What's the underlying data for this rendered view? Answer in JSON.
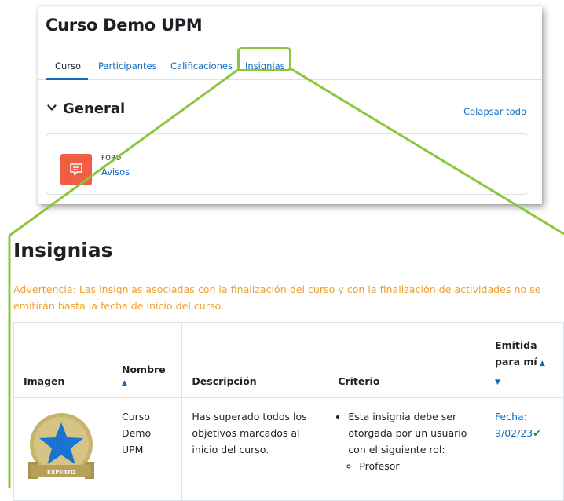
{
  "course": {
    "title": "Curso Demo UPM",
    "tabs": [
      "Curso",
      "Participantes",
      "Calificaciones",
      "Insignias"
    ],
    "section_title": "General",
    "collapse_all": "Colapsar todo",
    "activity": {
      "type": "FORO",
      "name": "Avisos"
    }
  },
  "badges": {
    "title": "Insignias",
    "warning": "Advertencia: Las insignias asociadas con la finalización del curso y con la finalización de actividades no se emitirán hasta la fecha de inicio del curso.",
    "headers": {
      "image": "Imagen",
      "name": "Nombre",
      "description": "Descripción",
      "criteria": "Criterio",
      "issued_line1": "Emitida",
      "issued_line2": "para mí"
    },
    "rows": [
      {
        "badge_label": "EXPERTO",
        "name_line1": "Curso",
        "name_line2": "Demo UPM",
        "description": "Has superado todos los objetivos marcados al inicio del curso.",
        "criteria_main": "Esta insignia debe ser otorgada por un usuario con el siguiente rol:",
        "criteria_role": "Profesor",
        "date_label": "Fecha:",
        "date_value": "9/02/23"
      }
    ]
  },
  "colors": {
    "highlight": "#8cc63f",
    "link": "#0f6cbf",
    "warning": "#f0a030",
    "forum_icon": "#f05d43",
    "check": "#198754",
    "badge_gold": "#c9b26b",
    "badge_star": "#1a73d1"
  },
  "icons": {
    "chevron": "chevron-down-icon",
    "forum": "forum-chat-icon",
    "sort_up": "sort-asc-icon",
    "sort_down": "sort-desc-icon",
    "check": "check-icon",
    "badge": "star-badge-image"
  }
}
